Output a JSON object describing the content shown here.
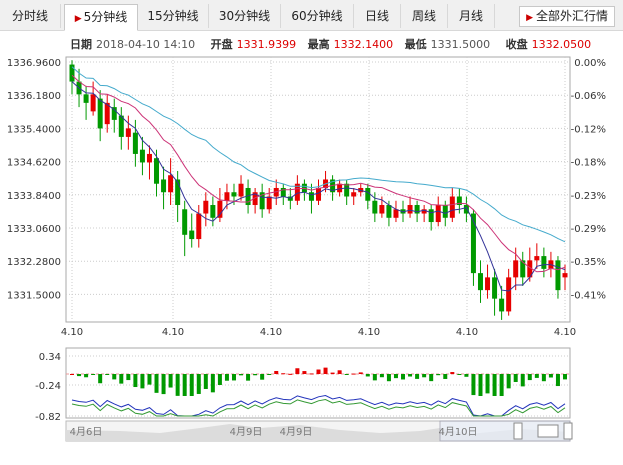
{
  "tabs": [
    {
      "label": "分时线"
    },
    {
      "label": "5分钟线",
      "active": true
    },
    {
      "label": "15分钟线"
    },
    {
      "label": "30分钟线"
    },
    {
      "label": "60分钟线"
    },
    {
      "label": "日线"
    },
    {
      "label": "周线"
    },
    {
      "label": "月线"
    }
  ],
  "fx_button": "全部外汇行情",
  "info": {
    "date_label": "日期",
    "date_value": "2018-04-10 14:10",
    "open_label": "开盘",
    "open_value": "1331.9399",
    "high_label": "最高",
    "high_value": "1332.1400",
    "low_label": "最低",
    "low_value": "1331.5000",
    "close_label": "收盘",
    "close_value": "1332.0500"
  },
  "colors": {
    "up": "#e60000",
    "down": "#009900",
    "ma5": "#333399",
    "ma10": "#cc3377",
    "ma20": "#44aacc"
  },
  "chart_data": {
    "type": "candlestick",
    "y_ticks": [
      "1336.9600",
      "1336.1800",
      "1335.4000",
      "1334.6200",
      "1333.8400",
      "1333.0600",
      "1332.2800",
      "1331.5000"
    ],
    "pct_ticks": [
      "0.00%",
      "-0.06%",
      "-0.12%",
      "-0.18%",
      "-0.23%",
      "-0.29%",
      "-0.35%",
      "-0.41%"
    ],
    "x_labels": [
      "4.10",
      "4.10",
      "4.10",
      "4.10",
      "4.10",
      "4.10"
    ],
    "ylim": [
      1331.0,
      1337.0
    ],
    "candles": [
      [
        1336.9,
        1336.5,
        1337.0,
        1336.2
      ],
      [
        1336.5,
        1336.2,
        1336.8,
        1335.9
      ],
      [
        1336.2,
        1336.0,
        1336.4,
        1335.6
      ],
      [
        1335.8,
        1336.2,
        1336.5,
        1335.7
      ],
      [
        1336.1,
        1335.4,
        1336.3,
        1335.1
      ],
      [
        1335.5,
        1336.0,
        1336.2,
        1335.3
      ],
      [
        1335.9,
        1335.6,
        1336.1,
        1335.3
      ],
      [
        1335.7,
        1335.2,
        1335.9,
        1334.9
      ],
      [
        1335.2,
        1335.4,
        1335.7,
        1334.9
      ],
      [
        1335.3,
        1334.8,
        1335.6,
        1334.5
      ],
      [
        1334.9,
        1334.6,
        1335.2,
        1334.3
      ],
      [
        1334.6,
        1334.8,
        1335.0,
        1334.2
      ],
      [
        1334.7,
        1334.1,
        1334.9,
        1333.8
      ],
      [
        1334.2,
        1333.9,
        1334.5,
        1333.5
      ],
      [
        1333.9,
        1334.3,
        1334.7,
        1333.6
      ],
      [
        1334.2,
        1333.6,
        1334.4,
        1333.2
      ],
      [
        1333.5,
        1332.9,
        1333.7,
        1332.4
      ],
      [
        1333.0,
        1332.8,
        1333.4,
        1332.6
      ],
      [
        1332.8,
        1333.4,
        1333.6,
        1332.6
      ],
      [
        1333.4,
        1333.7,
        1333.9,
        1333.1
      ],
      [
        1333.6,
        1333.3,
        1333.8,
        1333.1
      ],
      [
        1333.3,
        1333.7,
        1334.0,
        1333.2
      ],
      [
        1333.7,
        1333.9,
        1334.1,
        1333.5
      ],
      [
        1333.9,
        1333.8,
        1334.1,
        1333.6
      ],
      [
        1333.8,
        1334.1,
        1334.3,
        1333.7
      ],
      [
        1334.0,
        1333.6,
        1334.2,
        1333.4
      ],
      [
        1333.6,
        1333.9,
        1334.0,
        1333.4
      ],
      [
        1333.9,
        1333.5,
        1334.1,
        1333.3
      ],
      [
        1333.5,
        1333.8,
        1334.0,
        1333.4
      ],
      [
        1333.8,
        1334.0,
        1334.2,
        1333.6
      ],
      [
        1334.0,
        1333.8,
        1334.1,
        1333.6
      ],
      [
        1333.8,
        1333.7,
        1334.0,
        1333.5
      ],
      [
        1333.7,
        1334.1,
        1334.3,
        1333.6
      ],
      [
        1334.1,
        1333.9,
        1334.2,
        1333.7
      ],
      [
        1333.9,
        1333.7,
        1334.1,
        1333.4
      ],
      [
        1333.7,
        1334.0,
        1334.2,
        1333.6
      ],
      [
        1334.0,
        1334.2,
        1334.4,
        1333.9
      ],
      [
        1334.2,
        1333.9,
        1334.3,
        1333.7
      ],
      [
        1333.9,
        1334.1,
        1334.2,
        1333.8
      ],
      [
        1334.1,
        1333.8,
        1334.2,
        1333.6
      ],
      [
        1333.8,
        1333.9,
        1334.0,
        1333.6
      ],
      [
        1333.9,
        1334.0,
        1334.1,
        1333.8
      ],
      [
        1334.0,
        1333.7,
        1334.1,
        1333.5
      ],
      [
        1333.7,
        1333.4,
        1333.9,
        1333.2
      ],
      [
        1333.4,
        1333.6,
        1333.8,
        1333.3
      ],
      [
        1333.6,
        1333.3,
        1333.7,
        1333.1
      ],
      [
        1333.3,
        1333.5,
        1333.7,
        1333.2
      ],
      [
        1333.5,
        1333.4,
        1333.7,
        1333.2
      ],
      [
        1333.4,
        1333.6,
        1333.8,
        1333.3
      ],
      [
        1333.6,
        1333.4,
        1333.7,
        1333.2
      ],
      [
        1333.4,
        1333.5,
        1333.6,
        1333.2
      ],
      [
        1333.5,
        1333.2,
        1333.6,
        1333.0
      ],
      [
        1333.2,
        1333.6,
        1333.8,
        1333.1
      ],
      [
        1333.6,
        1333.3,
        1333.7,
        1333.1
      ],
      [
        1333.3,
        1333.8,
        1334.0,
        1333.2
      ],
      [
        1333.8,
        1333.6,
        1334.0,
        1333.4
      ],
      [
        1333.6,
        1333.4,
        1333.8,
        1333.2
      ],
      [
        1333.4,
        1332.0,
        1333.5,
        1331.7
      ],
      [
        1332.0,
        1331.6,
        1332.3,
        1331.3
      ],
      [
        1331.6,
        1331.9,
        1332.2,
        1331.4
      ],
      [
        1331.9,
        1331.4,
        1332.1,
        1331.0
      ],
      [
        1331.4,
        1331.1,
        1331.7,
        1330.9
      ],
      [
        1331.1,
        1331.9,
        1332.1,
        1331.0
      ],
      [
        1331.9,
        1332.3,
        1332.6,
        1331.6
      ],
      [
        1332.3,
        1331.9,
        1332.5,
        1331.7
      ],
      [
        1331.9,
        1332.3,
        1332.6,
        1331.8
      ],
      [
        1332.3,
        1332.4,
        1332.7,
        1332.1
      ],
      [
        1332.4,
        1332.1,
        1332.6,
        1331.9
      ],
      [
        1332.1,
        1332.3,
        1332.5,
        1331.9
      ],
      [
        1332.3,
        1331.6,
        1332.4,
        1331.4
      ],
      [
        1331.9,
        1332.0,
        1332.2,
        1331.6
      ]
    ],
    "indicator_ticks": [
      "0.34",
      "-0.24",
      "-0.82"
    ],
    "nav_labels": [
      "4月6日",
      "4月9日",
      "4月9日",
      "4月10日"
    ]
  }
}
